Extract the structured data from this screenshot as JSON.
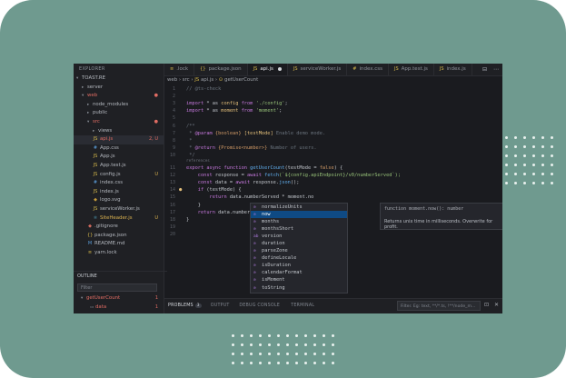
{
  "sidebar": {
    "title": "EXPLORER",
    "items": [
      {
        "label": "TOAST.RE",
        "kind": "root",
        "indent": 0
      },
      {
        "label": "server",
        "kind": "folder",
        "indent": 1
      },
      {
        "label": "web",
        "kind": "folder-open",
        "indent": 1,
        "state": "err",
        "badge": "●",
        "badge_color": "r"
      },
      {
        "label": "node_modules",
        "kind": "folder",
        "indent": 2
      },
      {
        "label": "public",
        "kind": "folder",
        "indent": 2
      },
      {
        "label": "src",
        "kind": "folder-open",
        "indent": 2,
        "state": "err",
        "badge": "●",
        "badge_color": "r"
      },
      {
        "label": "views",
        "kind": "folder",
        "indent": 3
      },
      {
        "label": "api.js",
        "kind": "js",
        "indent": 3,
        "state": "err",
        "badge": "2, U",
        "badge_color": "r",
        "selected": true
      },
      {
        "label": "App.css",
        "kind": "css",
        "indent": 3
      },
      {
        "label": "App.js",
        "kind": "js",
        "indent": 3
      },
      {
        "label": "App.test.js",
        "kind": "js",
        "indent": 3
      },
      {
        "label": "config.js",
        "kind": "js",
        "indent": 3,
        "badge": "U",
        "badge_color": "y"
      },
      {
        "label": "index.css",
        "kind": "css",
        "indent": 3
      },
      {
        "label": "index.js",
        "kind": "js",
        "indent": 3
      },
      {
        "label": "logo.svg",
        "kind": "img",
        "indent": 3
      },
      {
        "label": "serviceWorker.js",
        "kind": "js",
        "indent": 3
      },
      {
        "label": "SiteHeader.js",
        "kind": "react",
        "indent": 3,
        "state": "mod",
        "badge": "U",
        "badge_color": "y"
      },
      {
        "label": ".gitignore",
        "kind": "git",
        "indent": 2
      },
      {
        "label": "package.json",
        "kind": "json",
        "indent": 2
      },
      {
        "label": "README.md",
        "kind": "md",
        "indent": 2
      },
      {
        "label": "yarn.lock",
        "kind": "lock",
        "indent": 2
      }
    ],
    "outline_title": "OUTLINE",
    "filter_placeholder": "Filter",
    "outline_items": [
      {
        "label": "getUserCount",
        "state": "err",
        "badge": "1"
      },
      {
        "label": "data",
        "state": "err",
        "badge": "1"
      }
    ]
  },
  "tabs": [
    {
      "label": ".lock",
      "icon": "lock"
    },
    {
      "label": "package.json",
      "icon": "json"
    },
    {
      "label": "api.js",
      "icon": "js",
      "active": true,
      "dirty": true
    },
    {
      "label": "serviceWorker.js",
      "icon": "js"
    },
    {
      "label": "index.css",
      "icon": "css"
    },
    {
      "label": "App.test.js",
      "icon": "js"
    },
    {
      "label": "index.js",
      "icon": "js"
    }
  ],
  "breadcrumbs": [
    "web",
    "src",
    "api.js",
    "getUserCount"
  ],
  "editor": {
    "line_numbers": [
      "1",
      "2",
      "3",
      "4",
      "5",
      "6",
      "7",
      "8",
      "9",
      "10",
      "11",
      "12",
      "13",
      "14",
      "15",
      "16",
      "17",
      "18",
      "19",
      "20"
    ],
    "hint": "references",
    "lines": [
      [
        {
          "t": "// @ts-check",
          "c": "cm"
        }
      ],
      [],
      [
        {
          "t": "import ",
          "c": "kw"
        },
        {
          "t": "* as ",
          "c": ""
        },
        {
          "t": "config ",
          "c": "vr"
        },
        {
          "t": "from ",
          "c": "kw"
        },
        {
          "t": "'./config'",
          "c": "str"
        },
        {
          "t": ";",
          "c": ""
        }
      ],
      [
        {
          "t": "import ",
          "c": "kw"
        },
        {
          "t": "* as ",
          "c": ""
        },
        {
          "t": "moment ",
          "c": "vr"
        },
        {
          "t": "from ",
          "c": "kw"
        },
        {
          "t": "'moment'",
          "c": "str"
        },
        {
          "t": ";",
          "c": ""
        }
      ],
      [],
      [
        {
          "t": "/**",
          "c": "cm"
        }
      ],
      [
        {
          "t": " * ",
          "c": "cm"
        },
        {
          "t": "@param ",
          "c": "kw"
        },
        {
          "t": "{boolean} ",
          "c": "tg"
        },
        {
          "t": "[testMode]",
          "c": "vr"
        },
        {
          "t": " Enable demo mode.",
          "c": "cm"
        }
      ],
      [
        {
          "t": " *",
          "c": "cm"
        }
      ],
      [
        {
          "t": " * ",
          "c": "cm"
        },
        {
          "t": "@return ",
          "c": "kw"
        },
        {
          "t": "{Promise<number>}",
          "c": "tg"
        },
        {
          "t": " Number of users.",
          "c": "cm"
        }
      ],
      [
        {
          "t": " */",
          "c": "cm"
        }
      ],
      [
        {
          "t": "export ",
          "c": "kw"
        },
        {
          "t": "async ",
          "c": "kw"
        },
        {
          "t": "function ",
          "c": "kw"
        },
        {
          "t": "getUserCount",
          "c": "fn"
        },
        {
          "t": "(testMode = ",
          "c": ""
        },
        {
          "t": "false",
          "c": "tg"
        },
        {
          "t": ") {",
          "c": ""
        }
      ],
      [
        {
          "t": "    const ",
          "c": "kw"
        },
        {
          "t": "response = ",
          "c": ""
        },
        {
          "t": "await ",
          "c": "kw"
        },
        {
          "t": "fetch",
          "c": "fn"
        },
        {
          "t": "(`${config.apiEndpoint}/v0/numberServed`);",
          "c": "str"
        }
      ],
      [
        {
          "t": "    const ",
          "c": "kw"
        },
        {
          "t": "data = ",
          "c": ""
        },
        {
          "t": "await ",
          "c": "kw"
        },
        {
          "t": "response.",
          "c": ""
        },
        {
          "t": "json",
          "c": "fn"
        },
        {
          "t": "();",
          "c": ""
        }
      ],
      [
        {
          "t": "    if ",
          "c": "kw"
        },
        {
          "t": "(testMode) {",
          "c": ""
        }
      ],
      [
        {
          "t": "        return ",
          "c": "kw"
        },
        {
          "t": "data.numberServed * moment.no",
          "c": ""
        }
      ],
      [
        {
          "t": "    }",
          "c": ""
        }
      ],
      [
        {
          "t": "    return ",
          "c": "kw"
        },
        {
          "t": "data.numberS",
          "c": ""
        }
      ],
      [
        {
          "t": "}",
          "c": ""
        }
      ],
      [],
      []
    ]
  },
  "suggest": {
    "items": [
      {
        "label": "normalizeUnits",
        "icon": "⊙"
      },
      {
        "label": "now",
        "icon": "⊙",
        "selected": true
      },
      {
        "label": "months",
        "icon": "⊙"
      },
      {
        "label": "monthsShort",
        "icon": "⊙"
      },
      {
        "label": "version",
        "icon": "abc"
      },
      {
        "label": "duration",
        "icon": "⊙"
      },
      {
        "label": "parseZone",
        "icon": "⊙"
      },
      {
        "label": "defineLocale",
        "icon": "⊙"
      },
      {
        "label": "isDuration",
        "icon": "⊙"
      },
      {
        "label": "calendarFormat",
        "icon": "⊙"
      },
      {
        "label": "isMoment",
        "icon": "⊙"
      },
      {
        "label": "toString",
        "icon": "⊙"
      }
    ],
    "detail_signature": "function moment.now(): number",
    "detail_description": "Returns unix time in milliseconds. Overwrite for profit."
  },
  "panel": {
    "tabs": [
      {
        "label": "PROBLEMS",
        "badge": "3",
        "active": true
      },
      {
        "label": "OUTPUT"
      },
      {
        "label": "DEBUG CONSOLE"
      },
      {
        "label": "TERMINAL"
      }
    ],
    "filter_placeholder": "Filter. Eg: text, **/*.ts, !**/node_m..."
  },
  "icons": {
    "split_editor": "split-editor-icon",
    "more": "more-icon",
    "collapse": "collapse-icon",
    "close": "close-icon",
    "bulb": "lightbulb-icon"
  },
  "colors": {
    "background": "#6f9a8f",
    "editor": "#1a1b1f",
    "sidebar": "#1f2024",
    "selection": "#0f4a84",
    "error": "#e06c63",
    "modified": "#d9b14f"
  }
}
